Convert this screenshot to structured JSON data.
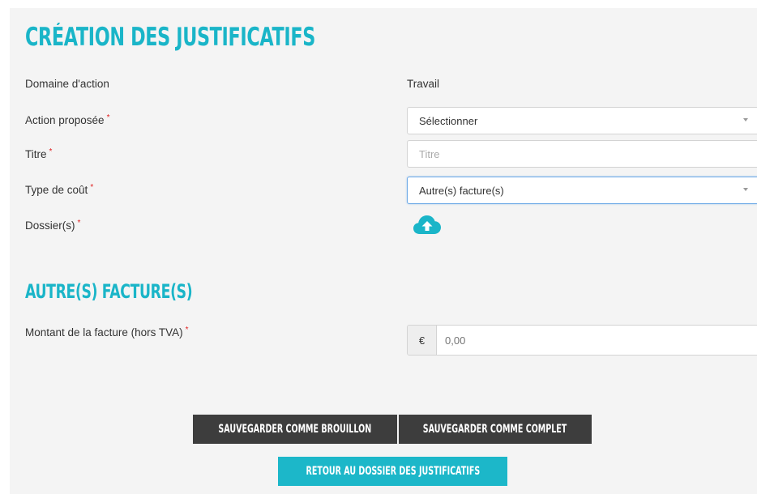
{
  "page": {
    "title": "Création des justificatifs",
    "section_title": "Autre(s) facture(s)"
  },
  "form": {
    "required_marker": "*",
    "domaine": {
      "label": "Domaine d'action",
      "value": "Travail"
    },
    "action": {
      "label": "Action proposée",
      "value": "Sélectionner"
    },
    "titre": {
      "label": "Titre",
      "placeholder": "Titre",
      "value": ""
    },
    "type_cout": {
      "label": "Type de coût",
      "value": "Autre(s) facture(s)"
    },
    "dossiers": {
      "label": "Dossier(s)",
      "icon": "cloud-upload-icon"
    },
    "montant": {
      "label": "Montant de la facture (hors TVA)",
      "currency": "€",
      "placeholder": "0,00"
    }
  },
  "buttons": {
    "save_draft": "Sauvegarder comme brouillon",
    "save_complete": "Sauvegarder comme complet",
    "back": "Retour au dossier des justificatifs"
  },
  "colors": {
    "accent": "#1ab5c8",
    "dark_button": "#3d3d3d",
    "required": "#e02020",
    "background": "#f4f4f4"
  }
}
